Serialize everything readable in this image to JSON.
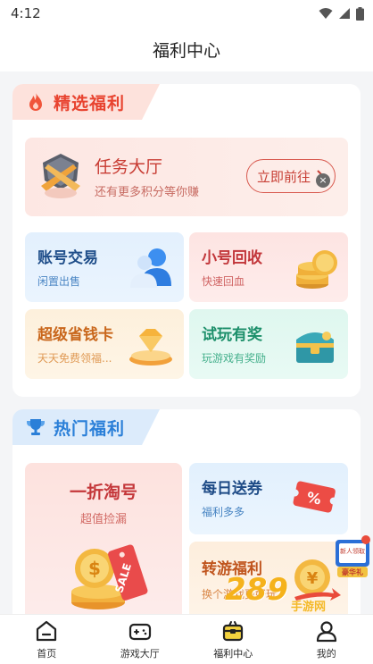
{
  "status_bar": {
    "time": "4:12"
  },
  "header": {
    "title": "福利中心"
  },
  "featured": {
    "title": "精选福利",
    "task": {
      "title": "任务大厅",
      "subtitle": "还有更多积分等你赚",
      "button": "立即前往"
    },
    "cards": [
      {
        "title": "账号交易",
        "subtitle": "闲置出售"
      },
      {
        "title": "小号回收",
        "subtitle": "快速回血"
      },
      {
        "title": "超级省钱卡",
        "subtitle": "天天免费领福..."
      },
      {
        "title": "试玩有奖",
        "subtitle": "玩游戏有奖励"
      }
    ]
  },
  "hot": {
    "title": "热门福利",
    "discount": {
      "title": "一折淘号",
      "subtitle": "超值捡漏",
      "tag": "SALE"
    },
    "coupon": {
      "title": "每日送券",
      "subtitle": "福利多多",
      "tag": "%"
    },
    "transfer": {
      "title": "转游福利",
      "subtitle": "换个游戏更好玩"
    }
  },
  "overlay": {
    "gift_text": "新人领取",
    "gift_tag": "豪华礼",
    "watermark": "289",
    "watermark_sub": "手游网"
  },
  "bottom_nav": [
    {
      "label": "首页",
      "icon": "home-icon"
    },
    {
      "label": "游戏大厅",
      "icon": "gamepad-icon"
    },
    {
      "label": "福利中心",
      "icon": "gift-box-icon",
      "active": true
    },
    {
      "label": "我的",
      "icon": "user-icon"
    }
  ],
  "colors": {
    "accent_red": "#e8432f",
    "accent_blue": "#2a7fd8",
    "background": "#f4f5f7"
  }
}
